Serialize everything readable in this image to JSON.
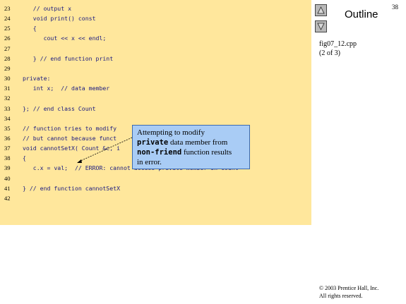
{
  "slide": {
    "page_number": "38",
    "outline_title": "Outline",
    "file_name": "fig07_12.cpp",
    "file_part": "(2 of 3)",
    "copyright_line1": "© 2003 Prentice Hall, Inc.",
    "copyright_line2": "All rights reserved."
  },
  "nav": {
    "up_icon": "triangle-up-icon",
    "down_icon": "triangle-down-icon"
  },
  "code_lines": [
    {
      "num": "23",
      "text": "   // output x"
    },
    {
      "num": "24",
      "text": "   void print() const"
    },
    {
      "num": "25",
      "text": "   {"
    },
    {
      "num": "26",
      "text": "      cout << x << endl;"
    },
    {
      "num": "27",
      "text": ""
    },
    {
      "num": "28",
      "text": "   } // end function print"
    },
    {
      "num": "29",
      "text": ""
    },
    {
      "num": "30",
      "text": "private:"
    },
    {
      "num": "31",
      "text": "   int x;  // data member"
    },
    {
      "num": "32",
      "text": ""
    },
    {
      "num": "33",
      "text": "}; // end class Count"
    },
    {
      "num": "34",
      "text": ""
    },
    {
      "num": "35",
      "text": "// function tries to modify"
    },
    {
      "num": "36",
      "text": "// but cannot because funct"
    },
    {
      "num": "37",
      "text": "void cannotSetX( Count &c, i"
    },
    {
      "num": "38",
      "text": "{"
    },
    {
      "num": "39",
      "text": "   c.x = val;  // ERROR: cannot access private member in Count"
    },
    {
      "num": "40",
      "text": ""
    },
    {
      "num": "41",
      "text": "} // end function cannotSetX"
    },
    {
      "num": "42",
      "text": ""
    }
  ],
  "callout": {
    "line1": "Attempting to modify",
    "mono1": "private",
    "after_mono1": " data member from",
    "mono2": "non-friend",
    "after_mono2": " function results",
    "line4": "in error."
  },
  "colors": {
    "code_background": "#FFE79C",
    "callout_background": "#A9CCF5"
  }
}
